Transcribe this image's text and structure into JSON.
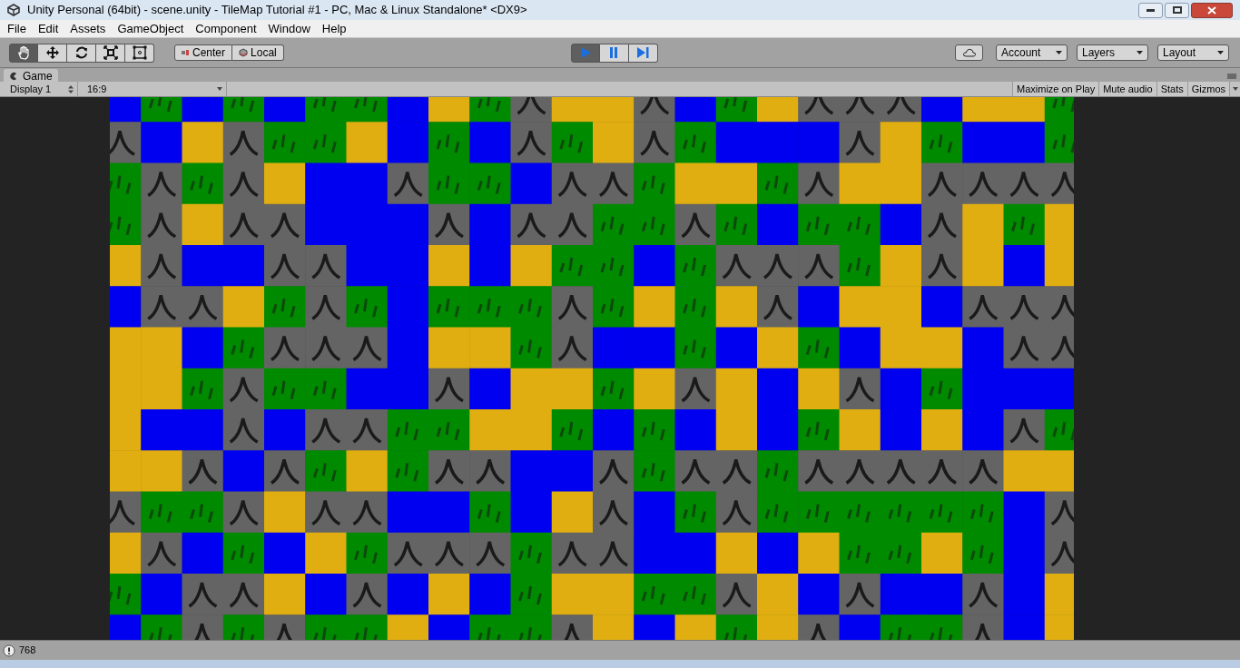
{
  "window": {
    "title": "Unity Personal (64bit) - scene.unity - TileMap Tutorial #1 - PC, Mac & Linux Standalone* <DX9>"
  },
  "menu": [
    "File",
    "Edit",
    "Assets",
    "GameObject",
    "Component",
    "Window",
    "Help"
  ],
  "transform_tools": [
    {
      "kind": "hand",
      "selected": true
    },
    {
      "kind": "move",
      "selected": false
    },
    {
      "kind": "rotate",
      "selected": false
    },
    {
      "kind": "scale",
      "selected": false
    },
    {
      "kind": "rect",
      "selected": false
    }
  ],
  "pivot_buttons": [
    {
      "kind": "pivot",
      "label": "Center"
    },
    {
      "kind": "space",
      "label": "Local"
    }
  ],
  "play_controls": [
    {
      "kind": "play",
      "selected": true
    },
    {
      "kind": "pause",
      "selected": false
    },
    {
      "kind": "step",
      "selected": false
    }
  ],
  "right_toolbar": [
    {
      "kind": "cloud"
    },
    {
      "kind": "dropdown",
      "label": "Account"
    },
    {
      "kind": "dropdown",
      "label": "Layers"
    },
    {
      "kind": "dropdown",
      "label": "Layout"
    }
  ],
  "game_tab": {
    "title": "Game"
  },
  "game_toolbar": {
    "display": "Display 1",
    "aspect": "16:9",
    "toggles": [
      {
        "label": "Maximize on Play",
        "on": false
      },
      {
        "label": "Mute audio",
        "on": false
      },
      {
        "label": "Stats",
        "on": false
      },
      {
        "label": "Gizmos",
        "on": false
      }
    ]
  },
  "status_bar": {
    "message": "768"
  }
}
